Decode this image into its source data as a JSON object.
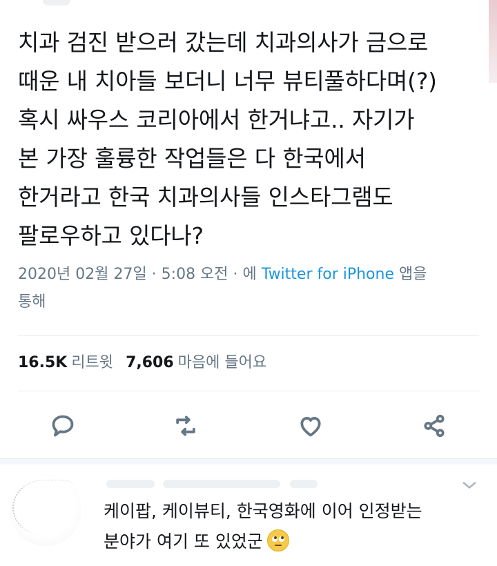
{
  "tweet": {
    "text": "치과 검진 받으러 갔는데 치과의사가 금으로\n때운 내 치아들 보더니 너무 뷰티풀하다며(?)\n혹시 싸우스 코리아에서 한거냐고.. 자기가\n본 가장 훌륭한 작업들은 다 한국에서\n한거라고 한국 치과의사들 인스타그램도\n팔로우하고 있다나?",
    "meta_prefix": "2020년 02월 27일 · 5:08 오전 · 에 ",
    "meta_source": "Twitter for iPhone",
    "meta_suffix": " 앱을\n통해"
  },
  "stats": {
    "retweets_value": "16.5K",
    "retweets_label": "리트윗",
    "likes_value": "7,606",
    "likes_label": "마음에 들어요"
  },
  "actions": {
    "reply_icon": "reply-bubble-icon",
    "retweet_icon": "retweet-arrows-icon",
    "like_icon": "heart-icon",
    "share_icon": "share-nodes-icon"
  },
  "reply": {
    "text": "케이팝, 케이뷰티, 한국영화에 이어 인정받는\n분야가 여기 또 있었군",
    "emoji": "face-with-rolling-eyes-icon"
  },
  "colors": {
    "text": "#14171a",
    "muted": "#657786",
    "link": "#1b95e0",
    "divider": "#e6ecf0"
  }
}
